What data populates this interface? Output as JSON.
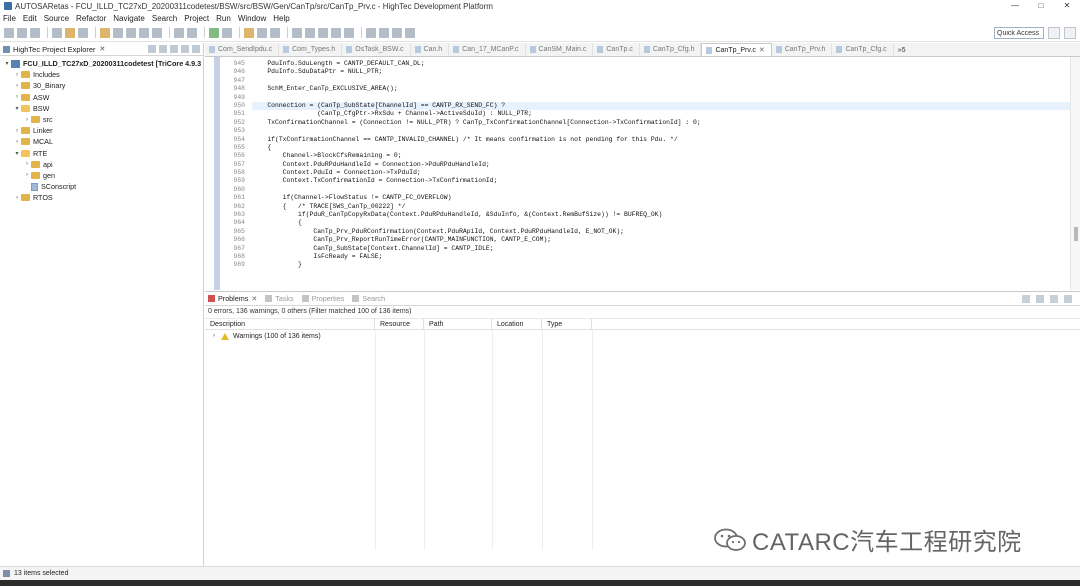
{
  "window": {
    "title": "AUTOSARetas - FCU_ILLD_TC27xD_20200311codetest/BSW/src/BSW/Gen/CanTp/src/CanTp_Prv.c - HighTec Development Platform",
    "minimize": "—",
    "maximize": "□",
    "close": "✕"
  },
  "menu": [
    "File",
    "Edit",
    "Source",
    "Refactor",
    "Navigate",
    "Search",
    "Project",
    "Run",
    "Window",
    "Help"
  ],
  "toolbar": {
    "quick_access": "Quick Access"
  },
  "explorer": {
    "title": "HighTec Project Explorer",
    "close": "✕",
    "items": [
      {
        "label": "FCU_ILLD_TC27xD_20200311codetest [TriCore 4.9.3",
        "arrow": "▾",
        "kind": "project",
        "depth": 0
      },
      {
        "label": "Includes",
        "arrow": "›",
        "kind": "folder",
        "depth": 1
      },
      {
        "label": "30_Binary",
        "arrow": "›",
        "kind": "folder",
        "depth": 1
      },
      {
        "label": "ASW",
        "arrow": "›",
        "kind": "folder",
        "depth": 1
      },
      {
        "label": "BSW",
        "arrow": "▾",
        "kind": "folder-open",
        "depth": 1
      },
      {
        "label": "src",
        "arrow": "›",
        "kind": "folder",
        "depth": 2
      },
      {
        "label": "Linker",
        "arrow": "›",
        "kind": "folder",
        "depth": 1
      },
      {
        "label": "MCAL",
        "arrow": "›",
        "kind": "folder",
        "depth": 1
      },
      {
        "label": "RTE",
        "arrow": "▾",
        "kind": "folder-open",
        "depth": 1
      },
      {
        "label": "api",
        "arrow": "›",
        "kind": "folder",
        "depth": 2
      },
      {
        "label": "gen",
        "arrow": "›",
        "kind": "folder",
        "depth": 2
      },
      {
        "label": "SConscript",
        "arrow": "",
        "kind": "file",
        "depth": 2
      },
      {
        "label": "RTOS",
        "arrow": "›",
        "kind": "folder",
        "depth": 1
      }
    ]
  },
  "editor": {
    "tabs": [
      {
        "label": "Com_SendIpdu.c",
        "active": false
      },
      {
        "label": "Com_Types.h",
        "active": false
      },
      {
        "label": "OsTask_BSW.c",
        "active": false
      },
      {
        "label": "Can.h",
        "active": false
      },
      {
        "label": "Can_17_MCanP.c",
        "active": false
      },
      {
        "label": "CanSM_Main.c",
        "active": false
      },
      {
        "label": "CanTp.c",
        "active": false
      },
      {
        "label": "CanTp_Cfg.h",
        "active": false
      },
      {
        "label": "CanTp_Prv.c",
        "active": true
      },
      {
        "label": "CanTp_Prv.h",
        "active": false
      },
      {
        "label": "CanTp_Cfg.c",
        "active": false
      }
    ],
    "tab_close": "✕",
    "tab_overflow": "»5",
    "lines": [
      {
        "no": "945",
        "text": "    PduInfo.SduLength = CANTP_DEFAULT_CAN_DL;",
        "hl": false
      },
      {
        "no": "946",
        "text": "    PduInfo.SduDataPtr = NULL_PTR;",
        "hl": false
      },
      {
        "no": "947",
        "text": "",
        "hl": false
      },
      {
        "no": "948",
        "text": "    SchM_Enter_CanTp_EXCLUSIVE_AREA();",
        "hl": false
      },
      {
        "no": "949",
        "text": "",
        "hl": false
      },
      {
        "no": "950",
        "text": "    Connection = (CanTp_SubState[ChannelId] == CANTP_RX_SEND_FC) ?",
        "hl": true
      },
      {
        "no": "951",
        "text": "                 (CanTp_CfgPtr->RxSdu + Channel->ActiveSduId) : NULL_PTR;",
        "hl": false
      },
      {
        "no": "952",
        "text": "    TxConfirmationChannel = (Connection != NULL_PTR) ? CanTp_TxConfirmationChannel[Connection->TxConfirmationId] : 0;",
        "hl": false
      },
      {
        "no": "953",
        "text": "",
        "hl": false
      },
      {
        "no": "954",
        "text": "    if(TxConfirmationChannel == CANTP_INVALID_CHANNEL) /* It means confirmation is not pending for this Pdu. */",
        "hl": false
      },
      {
        "no": "955",
        "text": "    {",
        "hl": false
      },
      {
        "no": "956",
        "text": "        Channel->BlockCfsRemaining = 0;",
        "hl": false
      },
      {
        "no": "957",
        "text": "        Context.PduRPduHandleId = Connection->PduRPduHandleId;",
        "hl": false
      },
      {
        "no": "958",
        "text": "        Context.PduId = Connection->TxPduId;",
        "hl": false
      },
      {
        "no": "959",
        "text": "        Context.TxConfirmationId = Connection->TxConfirmationId;",
        "hl": false
      },
      {
        "no": "960",
        "text": "",
        "hl": false
      },
      {
        "no": "961",
        "text": "        if(Channel->FlowStatus != CANTP_FC_OVERFLOW)",
        "hl": false
      },
      {
        "no": "962",
        "text": "        {   /* TRACE[SWS_CanTp_00222] */",
        "hl": false
      },
      {
        "no": "963",
        "text": "            if(PduR_CanTpCopyRxData(Context.PduRPduHandleId, &SduInfo, &(Context.RemBufSize)) != BUFREQ_OK)",
        "hl": false
      },
      {
        "no": "964",
        "text": "            {",
        "hl": false
      },
      {
        "no": "965",
        "text": "                CanTp_Prv_PduRConfirmation(Context.PduRApiId, Context.PduRPduHandleId, E_NOT_OK);",
        "hl": false
      },
      {
        "no": "966",
        "text": "                CanTp_Prv_ReportRunTimeError(CANTP_MAINFUNCTION, CANTP_E_COM);",
        "hl": false
      },
      {
        "no": "967",
        "text": "                CanTp_SubState[Context.ChannelId] = CANTP_IDLE;",
        "hl": false
      },
      {
        "no": "968",
        "text": "                IsFcReady = FALSE;",
        "hl": false
      },
      {
        "no": "969",
        "text": "            }",
        "hl": false
      }
    ]
  },
  "problems": {
    "tabs": [
      {
        "label": "Problems",
        "active": true
      },
      {
        "label": "Tasks",
        "active": false
      },
      {
        "label": "Properties",
        "active": false
      },
      {
        "label": "Search",
        "active": false
      }
    ],
    "tab_close": "✕",
    "summary": "0 errors, 136 warnings, 0 others (Filter matched 100 of 136 items)",
    "columns": [
      "Description",
      "Resource",
      "Path",
      "Location",
      "Type"
    ],
    "rows": [
      {
        "arrow": "›",
        "label": "Warnings (100 of 136 items)"
      }
    ]
  },
  "status": {
    "text": "13 items selected"
  },
  "watermark": {
    "text": "CATARC汽车工程研究院"
  }
}
